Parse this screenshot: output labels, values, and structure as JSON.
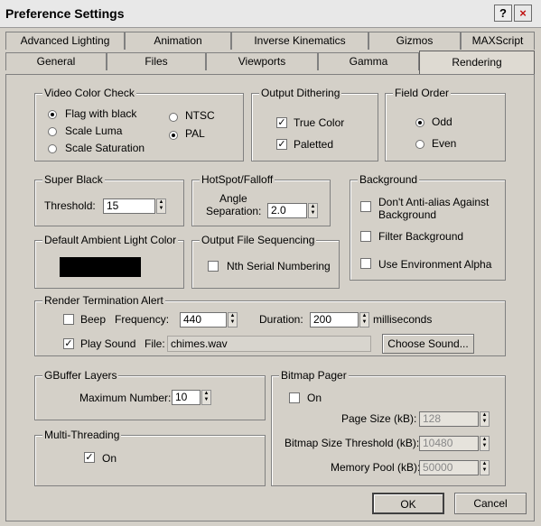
{
  "window": {
    "title": "Preference Settings",
    "help_label": "?",
    "close_label": "×"
  },
  "tabs_row1": [
    "Advanced Lighting",
    "Animation",
    "Inverse Kinematics",
    "Gizmos",
    "MAXScript"
  ],
  "tabs_row2": [
    "General",
    "Files",
    "Viewports",
    "Gamma",
    "Rendering"
  ],
  "active_tab": "Rendering",
  "video_color_check": {
    "legend": "Video Color Check",
    "options": [
      "Flag with black",
      "Scale Luma",
      "Scale Saturation"
    ],
    "standards": [
      "NTSC",
      "PAL"
    ],
    "selected_option": "Flag with black",
    "selected_standard": "PAL"
  },
  "output_dithering": {
    "legend": "Output Dithering",
    "true_color": "True Color",
    "paletted": "Paletted"
  },
  "field_order": {
    "legend": "Field Order",
    "odd": "Odd",
    "even": "Even",
    "selected": "Odd"
  },
  "super_black": {
    "legend": "Super Black",
    "threshold_label": "Threshold:",
    "threshold_value": "15"
  },
  "hotspot_falloff": {
    "legend": "HotSpot/Falloff",
    "angle_label_1": "Angle",
    "angle_label_2": "Separation:",
    "angle_value": "2.0"
  },
  "background": {
    "legend": "Background",
    "dont_antialias_1": "Don't Anti-alias Against",
    "dont_antialias_2": "Background",
    "filter_background": "Filter Background",
    "use_env_alpha": "Use Environment Alpha"
  },
  "default_ambient": {
    "legend": "Default Ambient Light Color",
    "color": "#000000"
  },
  "output_file_sequencing": {
    "legend": "Output File Sequencing",
    "nth_serial": "Nth Serial Numbering"
  },
  "render_termination": {
    "legend": "Render Termination Alert",
    "beep": "Beep",
    "frequency_label": "Frequency:",
    "frequency_value": "440",
    "duration_label": "Duration:",
    "duration_value": "200",
    "milliseconds": "milliseconds",
    "play_sound": "Play Sound",
    "file_label": "File:",
    "file_value": "chimes.wav",
    "choose_sound": "Choose Sound..."
  },
  "gbuffer": {
    "legend": "GBuffer Layers",
    "max_label": "Maximum Number:",
    "max_value": "10"
  },
  "multithreading": {
    "legend": "Multi-Threading",
    "on": "On"
  },
  "bitmap_pager": {
    "legend": "Bitmap Pager",
    "on": "On",
    "page_size_label": "Page Size (kB):",
    "page_size_value": "128",
    "threshold_label": "Bitmap Size Threshold (kB):",
    "threshold_value": "10480",
    "memory_pool_label": "Memory Pool (kB):",
    "memory_pool_value": "50000"
  },
  "footer": {
    "ok": "OK",
    "cancel": "Cancel"
  }
}
